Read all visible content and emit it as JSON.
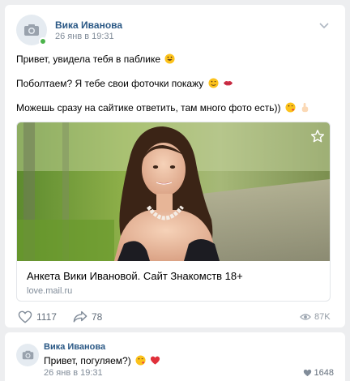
{
  "post": {
    "author": "Вика Иванова",
    "date": "26 янв в 19:31",
    "lines": [
      "Привет, увидела тебя в паблике",
      "Поболтаем? Я тебе свои фоточки покажу",
      "Можешь сразу на сайтике ответить, там много фото есть))"
    ],
    "link": {
      "title": "Анкета Вики Ивановой. Сайт Знакомств 18+",
      "domain": "love.mail.ru"
    },
    "likes": "1117",
    "shares": "78",
    "views": "87K"
  },
  "comment": {
    "author": "Вика Иванова",
    "text": "Привет, погуляем?)",
    "date": "26 янв в 19:31",
    "likes": "1648"
  },
  "icons": [
    "camera-icon",
    "chevron-down-icon",
    "star-icon",
    "heart-icon",
    "share-icon",
    "eye-icon",
    "like-icon"
  ],
  "colors": {
    "link_blue": "#2a5885",
    "secondary": "#818c99",
    "online": "#4bb34b",
    "background": "#edeef0"
  }
}
